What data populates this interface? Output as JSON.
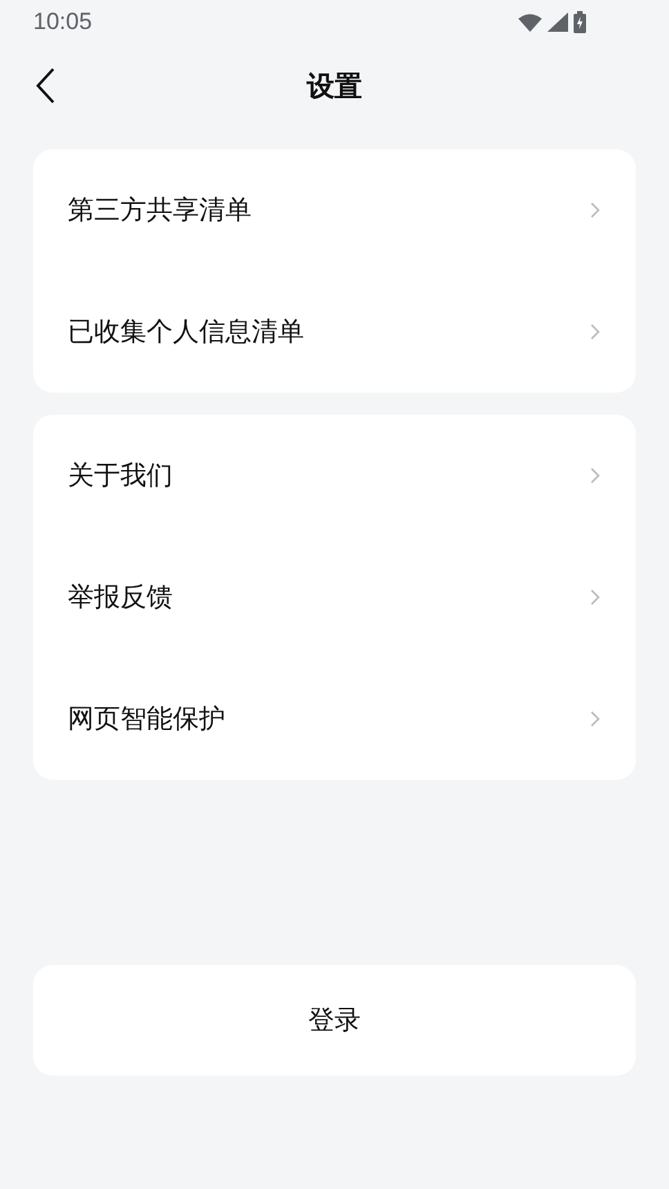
{
  "status_bar": {
    "time": "10:05"
  },
  "header": {
    "title": "设置"
  },
  "groups": [
    {
      "items": [
        "第三方共享清单",
        "已收集个人信息清单"
      ]
    },
    {
      "items": [
        "关于我们",
        "举报反馈",
        "网页智能保护"
      ]
    }
  ],
  "login_button": "登录"
}
